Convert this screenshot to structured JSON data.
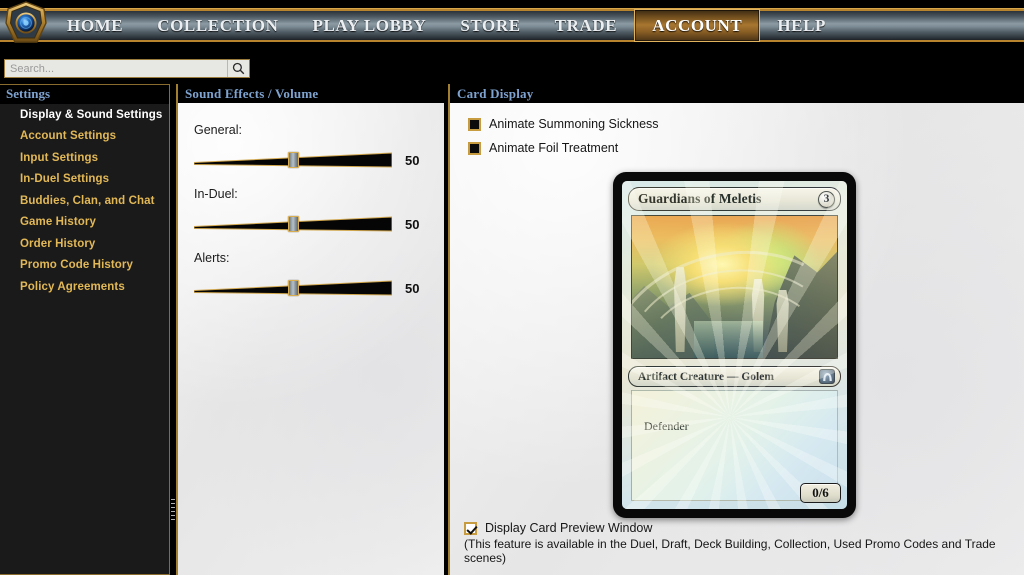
{
  "nav": {
    "logo_icon": "orb-logo-icon",
    "items": [
      {
        "label": "HOME",
        "selected": false
      },
      {
        "label": "COLLECTION",
        "selected": false
      },
      {
        "label": "PLAY LOBBY",
        "selected": false
      },
      {
        "label": "STORE",
        "selected": false
      },
      {
        "label": "TRADE",
        "selected": false
      },
      {
        "label": "ACCOUNT",
        "selected": true
      },
      {
        "label": "HELP",
        "selected": false
      }
    ]
  },
  "search": {
    "placeholder": "Search...",
    "value": "",
    "button_icon": "search-icon"
  },
  "sidebar": {
    "title": "Settings",
    "items": [
      {
        "label": "Display & Sound Settings",
        "selected": true
      },
      {
        "label": "Account Settings",
        "selected": false
      },
      {
        "label": "Input Settings",
        "selected": false
      },
      {
        "label": "In-Duel Settings",
        "selected": false
      },
      {
        "label": "Buddies, Clan, and Chat",
        "selected": false
      },
      {
        "label": "Game History",
        "selected": false
      },
      {
        "label": "Order History",
        "selected": false
      },
      {
        "label": "Promo Code History",
        "selected": false
      },
      {
        "label": "Policy Agreements",
        "selected": false
      }
    ]
  },
  "sound_panel": {
    "title": "Sound Effects / Volume",
    "sliders": [
      {
        "label": "General:",
        "value": "50",
        "percent": 50
      },
      {
        "label": "In-Duel:",
        "value": "50",
        "percent": 50
      },
      {
        "label": "Alerts:",
        "value": "50",
        "percent": 50
      }
    ]
  },
  "card_panel": {
    "title": "Card Display",
    "options": [
      {
        "label": "Animate Summoning Sickness",
        "checked": false
      },
      {
        "label": "Animate Foil Treatment",
        "checked": false
      }
    ],
    "preview": {
      "label": "Display Card Preview Window",
      "checked": true,
      "note": "(This feature is available in the Duel, Draft, Deck Building, Collection, Used Promo Codes and Trade scenes)"
    },
    "card": {
      "name": "Guardians of Meletis",
      "mana_cost": "3",
      "type_line": "Artifact Creature — Golem",
      "set_symbol_icon": "magic-origins-set-icon",
      "rules_text": "Defender",
      "power_toughness": "0/6",
      "foil": true
    }
  },
  "colors": {
    "gold_border": "#a3802f",
    "gold_text": "#e2b857",
    "panel_header_text": "#7ea3d0",
    "panel_bg": "#efefef",
    "sidebar_bg": "#1a1a1a",
    "nav_selected_border": "#e0b45e"
  }
}
